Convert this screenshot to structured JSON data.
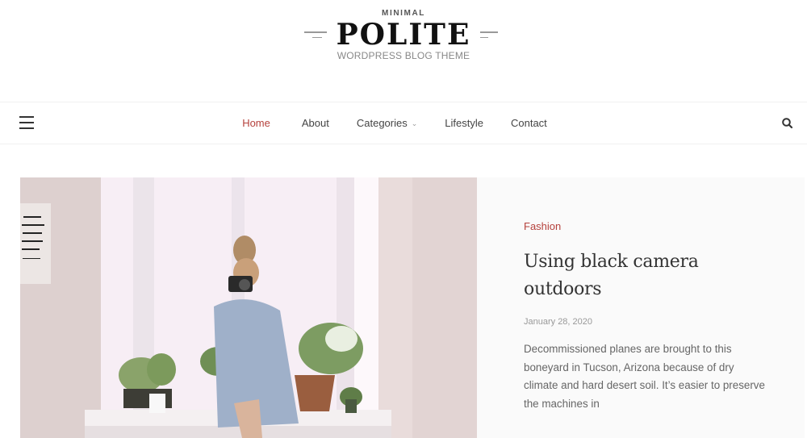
{
  "header": {
    "tagline_top": "MINIMAL",
    "site_title": "POLITE",
    "site_subtitle": "WORDPRESS BLOG THEME"
  },
  "nav": {
    "menu_icon": "hamburger-menu-icon",
    "items": [
      {
        "label": "Home",
        "active": true
      },
      {
        "label": "About",
        "active": false
      },
      {
        "label": "Categories",
        "active": false,
        "has_dropdown": true,
        "dropdown_icon": "chevron-down-icon"
      },
      {
        "label": "Lifestyle",
        "active": false
      },
      {
        "label": "Contact",
        "active": false
      }
    ],
    "search_icon": "search-icon"
  },
  "featured_post": {
    "image_description": "Woman in blue dress sitting on a windowsill holding a camera, surrounded by potted plants",
    "category": "Fashion",
    "title": "Using black camera outdoors",
    "date": "January 28, 2020",
    "excerpt": "Decommissioned planes are brought to this boneyard in Tucson, Arizona because of dry climate and hard desert soil. It’s easier to preserve the machines in"
  },
  "colors": {
    "accent": "#b5413c",
    "text_dark": "#333333",
    "text_muted": "#999999",
    "panel_bg": "#fafafa"
  }
}
